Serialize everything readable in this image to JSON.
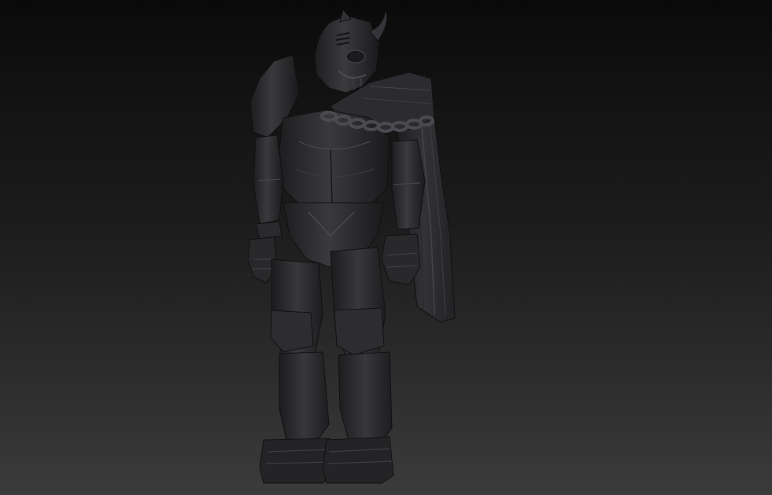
{
  "scene": {
    "subject": "armored-demon-sculpt",
    "background": {
      "top": "#0a0a0a",
      "bottom": "#3b3b3b"
    },
    "material_colors": {
      "base": "#2f2f32",
      "shadow": "#151517",
      "highlight": "#4a4a4f",
      "rim": "#5c5c62"
    }
  }
}
